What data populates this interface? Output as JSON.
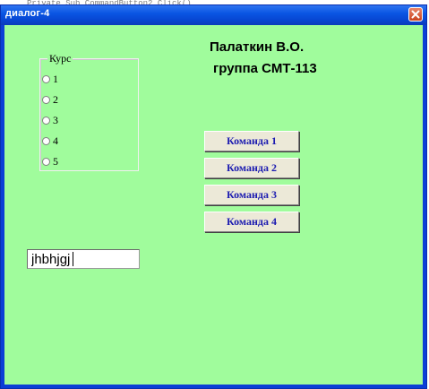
{
  "background_code": "Private Sub CommandButton2_Click()",
  "window": {
    "title": "диалог-4"
  },
  "header": {
    "name": "Палаткин В.О.",
    "group": "группа СМТ-113"
  },
  "course_frame": {
    "legend": "Курс",
    "options": [
      "1",
      "2",
      "3",
      "4",
      "5"
    ]
  },
  "buttons": {
    "cmd1": "Команда 1",
    "cmd2": "Команда 2",
    "cmd3": "Команда 3",
    "cmd4": "Команда 4"
  },
  "text_field": {
    "value": "jhbhjgj"
  },
  "colors": {
    "client_background": "#a0fc9c",
    "titlebar": "#0a56e3",
    "button_text": "#1a1ab0"
  }
}
